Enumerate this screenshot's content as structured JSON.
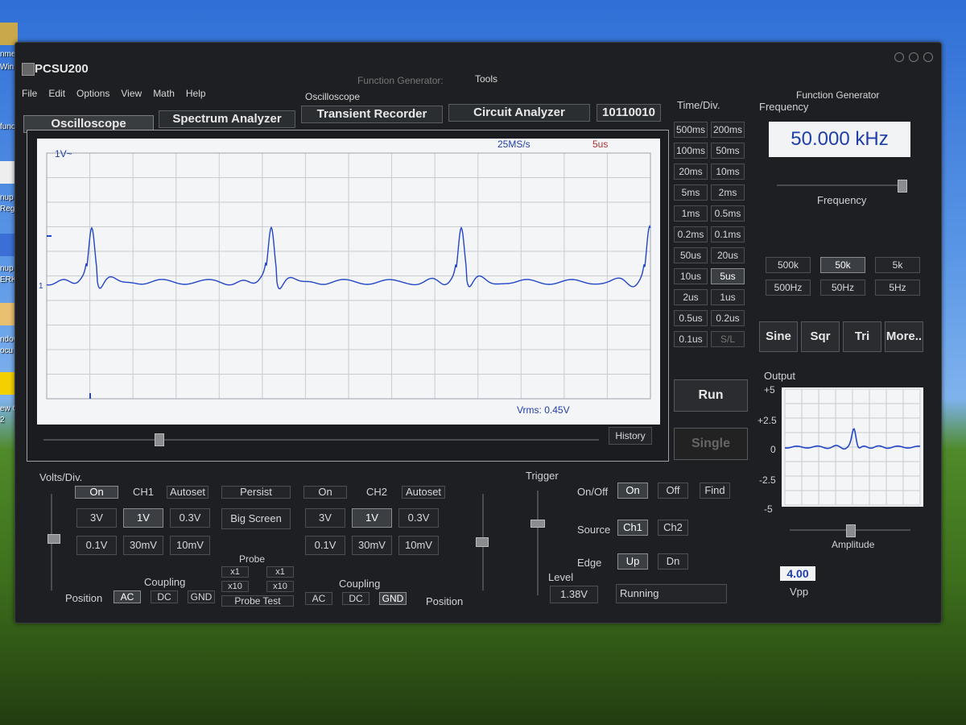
{
  "desktop": {
    "icon_labels": [
      "nmers Notepad",
      "Win",
      "func",
      "nup",
      "Reg",
      "nup",
      "ERK",
      "ndow",
      "ocu",
      "ew C",
      "2"
    ]
  },
  "app": {
    "title": "PCSU200",
    "menu": [
      "File",
      "Edit",
      "Options",
      "View",
      "Math",
      "Help"
    ],
    "header_labels": {
      "oscilloscope": "Oscilloscope",
      "function_generator_dim": "Function Generator:",
      "tools": "Tools",
      "function_generator": "Function Generator"
    },
    "tabs": {
      "oscilloscope": "Oscilloscope",
      "spectrum": "Spectrum Analyzer",
      "transient": "Transient Recorder",
      "circuit": "Circuit Analyzer",
      "digital": "10110010"
    }
  },
  "scope": {
    "ch_marker": "1V~",
    "sample_rate": "25MS/s",
    "timebase": "5us",
    "vrms": "Vrms: 0.45V",
    "level_marker": "1",
    "history": "History"
  },
  "timediv": {
    "label": "Time/Div.",
    "buttons": [
      "500ms",
      "200ms",
      "100ms",
      "50ms",
      "20ms",
      "10ms",
      "5ms",
      "2ms",
      "1ms",
      "0.5ms",
      "0.2ms",
      "0.1ms",
      "50us",
      "20us",
      "10us",
      "5us",
      "2us",
      "1us",
      "0.5us",
      "0.2us",
      "0.1us",
      "S/L"
    ],
    "selected": "5us",
    "run": "Run",
    "single": "Single"
  },
  "generator": {
    "frequency_label": "Frequency",
    "frequency_value": "50.000 kHz",
    "slider_label": "Frequency",
    "range_buttons": [
      "500k",
      "50k",
      "5k",
      "500Hz",
      "50Hz",
      "5Hz"
    ],
    "range_selected": "50k",
    "wave_buttons": [
      "Sine",
      "Sqr",
      "Tri",
      "More.."
    ],
    "output_label": "Output",
    "output_ticks": [
      "+5",
      "+2.5",
      "0",
      "-2.5",
      "-5"
    ],
    "amplitude_label": "Amplitude",
    "amplitude_value": "4.00",
    "amplitude_unit": "Vpp"
  },
  "volts": {
    "label": "Volts/Div.",
    "ch1": {
      "on": "On",
      "name": "CH1",
      "autoset": "Autoset",
      "v": [
        "3V",
        "1V",
        "0.3V",
        "0.1V",
        "30mV",
        "10mV"
      ],
      "selected": "1V",
      "coupling": [
        "AC",
        "DC",
        "GND"
      ],
      "coupling_selected": "AC"
    },
    "ch2": {
      "on": "On",
      "name": "CH2",
      "autoset": "Autoset",
      "v": [
        "3V",
        "1V",
        "0.3V",
        "0.1V",
        "30mV",
        "10mV"
      ],
      "selected": "1V",
      "coupling": [
        "AC",
        "DC",
        "GND"
      ],
      "coupling_selected": "GND"
    },
    "persist": "Persist",
    "big_screen": "Big Screen",
    "probe_label": "Probe",
    "probe_x1": "x1",
    "probe_x10": "x10",
    "probe_test": "Probe Test",
    "coupling_label": "Coupling",
    "position": "Position"
  },
  "trigger": {
    "label": "Trigger",
    "onoff_label": "On/Off",
    "on": "On",
    "off": "Off",
    "find": "Find",
    "source_label": "Source",
    "ch1": "Ch1",
    "ch2": "Ch2",
    "edge_label": "Edge",
    "up": "Up",
    "dn": "Dn",
    "level_label": "Level",
    "level_value": "1.38V",
    "status": "Running"
  }
}
